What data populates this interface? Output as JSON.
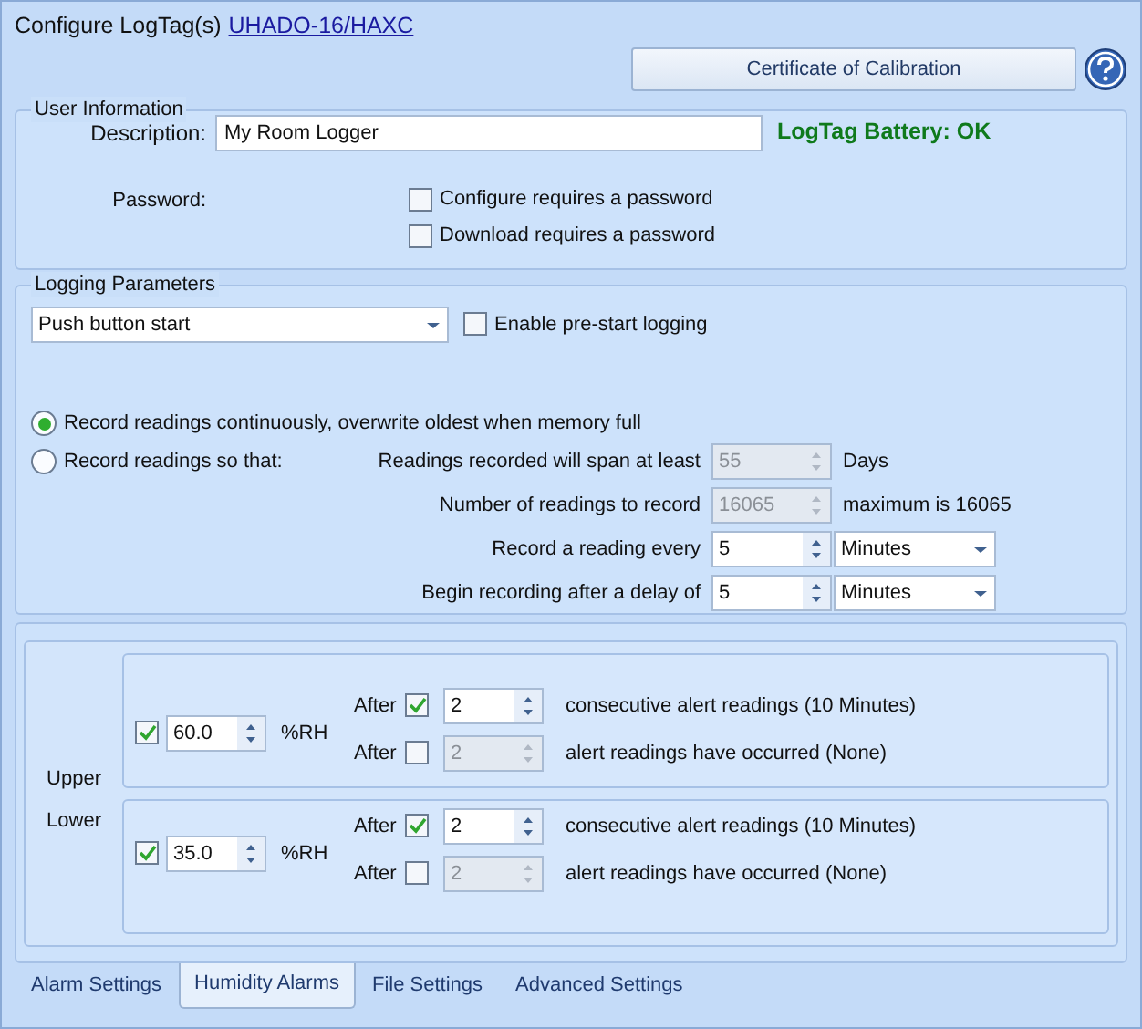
{
  "window": {
    "title": "Configure LogTag(s)",
    "device_link": "UHADO-16/HAXC"
  },
  "certificate_button": "Certificate of Calibration",
  "user_information": {
    "legend": "User Information",
    "description_label": "Description:",
    "description": "My Room Logger",
    "battery_status": "LogTag Battery: OK",
    "password_label": "Password:",
    "password_options": [
      {
        "label": "Configure requires a password",
        "checked": false
      },
      {
        "label": "Download requires a password",
        "checked": false
      }
    ]
  },
  "logging_parameters": {
    "legend": "Logging Parameters",
    "start_mode": "Push button start",
    "prestart": {
      "label": "Enable pre-start logging",
      "checked": false
    },
    "record_modes": [
      {
        "label": "Record readings continuously, overwrite oldest when memory full",
        "selected": true
      },
      {
        "label": "Record readings so that:",
        "selected": false
      }
    ],
    "settings": [
      {
        "label": "Readings recorded will span at least",
        "value": "55",
        "disabled": true,
        "suffix": "Days"
      },
      {
        "label": "Number of readings to record",
        "value": "16065",
        "disabled": true,
        "suffix": "maximum is 16065"
      },
      {
        "label": "Record a reading every",
        "value": "5",
        "disabled": false,
        "unit": "Minutes"
      },
      {
        "label": "Begin recording after a delay of",
        "value": "5",
        "disabled": false,
        "unit": "Minutes"
      }
    ]
  },
  "humidity_alarms": [
    {
      "label": "Upper",
      "enabled": true,
      "value": "60.0",
      "unit": "%RH",
      "rules": [
        {
          "label": "After",
          "checked": true,
          "value": "2",
          "text": "consecutive alert readings (10 Minutes)"
        },
        {
          "label": "After",
          "checked": false,
          "value": "2",
          "text": "alert readings have occurred (None)"
        }
      ]
    },
    {
      "label": "Lower",
      "enabled": true,
      "value": "35.0",
      "unit": "%RH",
      "rules": [
        {
          "label": "After",
          "checked": true,
          "value": "2",
          "text": "consecutive alert readings (10 Minutes)"
        },
        {
          "label": "After",
          "checked": false,
          "value": "2",
          "text": "alert readings have occurred (None)"
        }
      ]
    }
  ],
  "tabs": [
    {
      "label": "Alarm Settings",
      "selected": false
    },
    {
      "label": "Humidity Alarms",
      "selected": true
    },
    {
      "label": "File Settings",
      "selected": false
    },
    {
      "label": "Advanced Settings",
      "selected": false
    }
  ]
}
